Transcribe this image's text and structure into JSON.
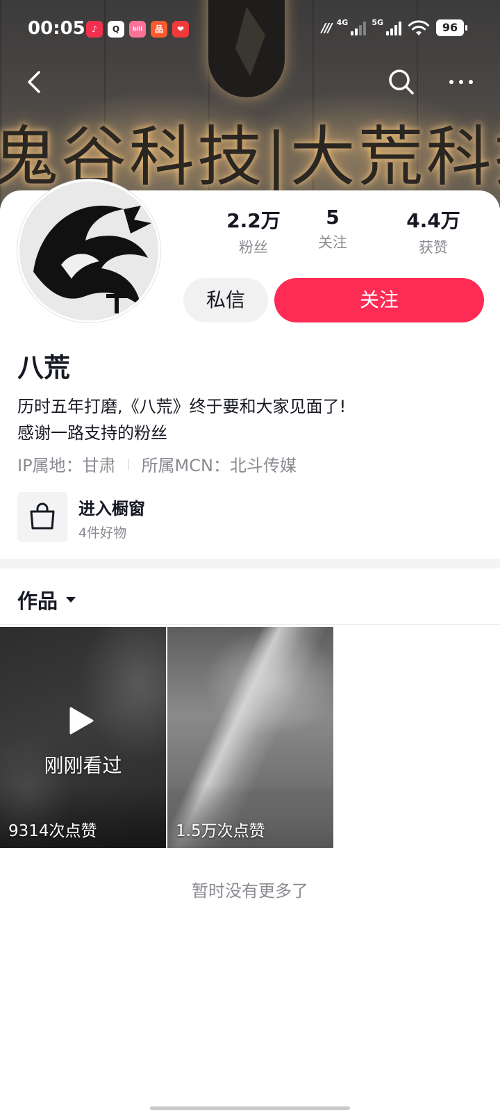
{
  "status_bar": {
    "time": "00:05",
    "notification_icons": [
      {
        "name": "douyin-icon",
        "glyph": "♪",
        "color": "#f2304e"
      },
      {
        "name": "qq-icon",
        "glyph": "Q",
        "color": "#ffffff"
      },
      {
        "name": "bilibili-icon",
        "glyph": "bili",
        "color": "#fb7299"
      },
      {
        "name": "xiaohongshu-icon",
        "glyph": "品",
        "color": "#ff5a2e"
      },
      {
        "name": "taobao-icon",
        "glyph": "❤",
        "color": "#f03a3a"
      }
    ],
    "net_4g": "4G",
    "net_5g": "5G",
    "battery": "96"
  },
  "cover": {
    "sign_text": "鬼谷科技|大荒科技"
  },
  "profile": {
    "stats": [
      {
        "value": "2.2万",
        "label": "粉丝"
      },
      {
        "value": "5",
        "label": "关注"
      },
      {
        "value": "4.4万",
        "label": "获赞"
      }
    ],
    "message_label": "私信",
    "follow_label": "关注",
    "follow_color": "#fe2c55",
    "name": "八荒",
    "bio_line1": "历时五年打磨,《八荒》终于要和大家见面了!",
    "bio_line2": "感谢一路支持的粉丝",
    "ip_location": "IP属地：甘肃",
    "mcn": "所属MCN：北斗传媒",
    "shop": {
      "title": "进入橱窗",
      "subtitle": "4件好物"
    }
  },
  "works": {
    "tab_label": "作品",
    "videos": [
      {
        "likes": "9314次点赞",
        "recent_label": "刚刚看过"
      },
      {
        "likes": "1.5万次点赞"
      }
    ],
    "end_note": "暂时没有更多了"
  }
}
